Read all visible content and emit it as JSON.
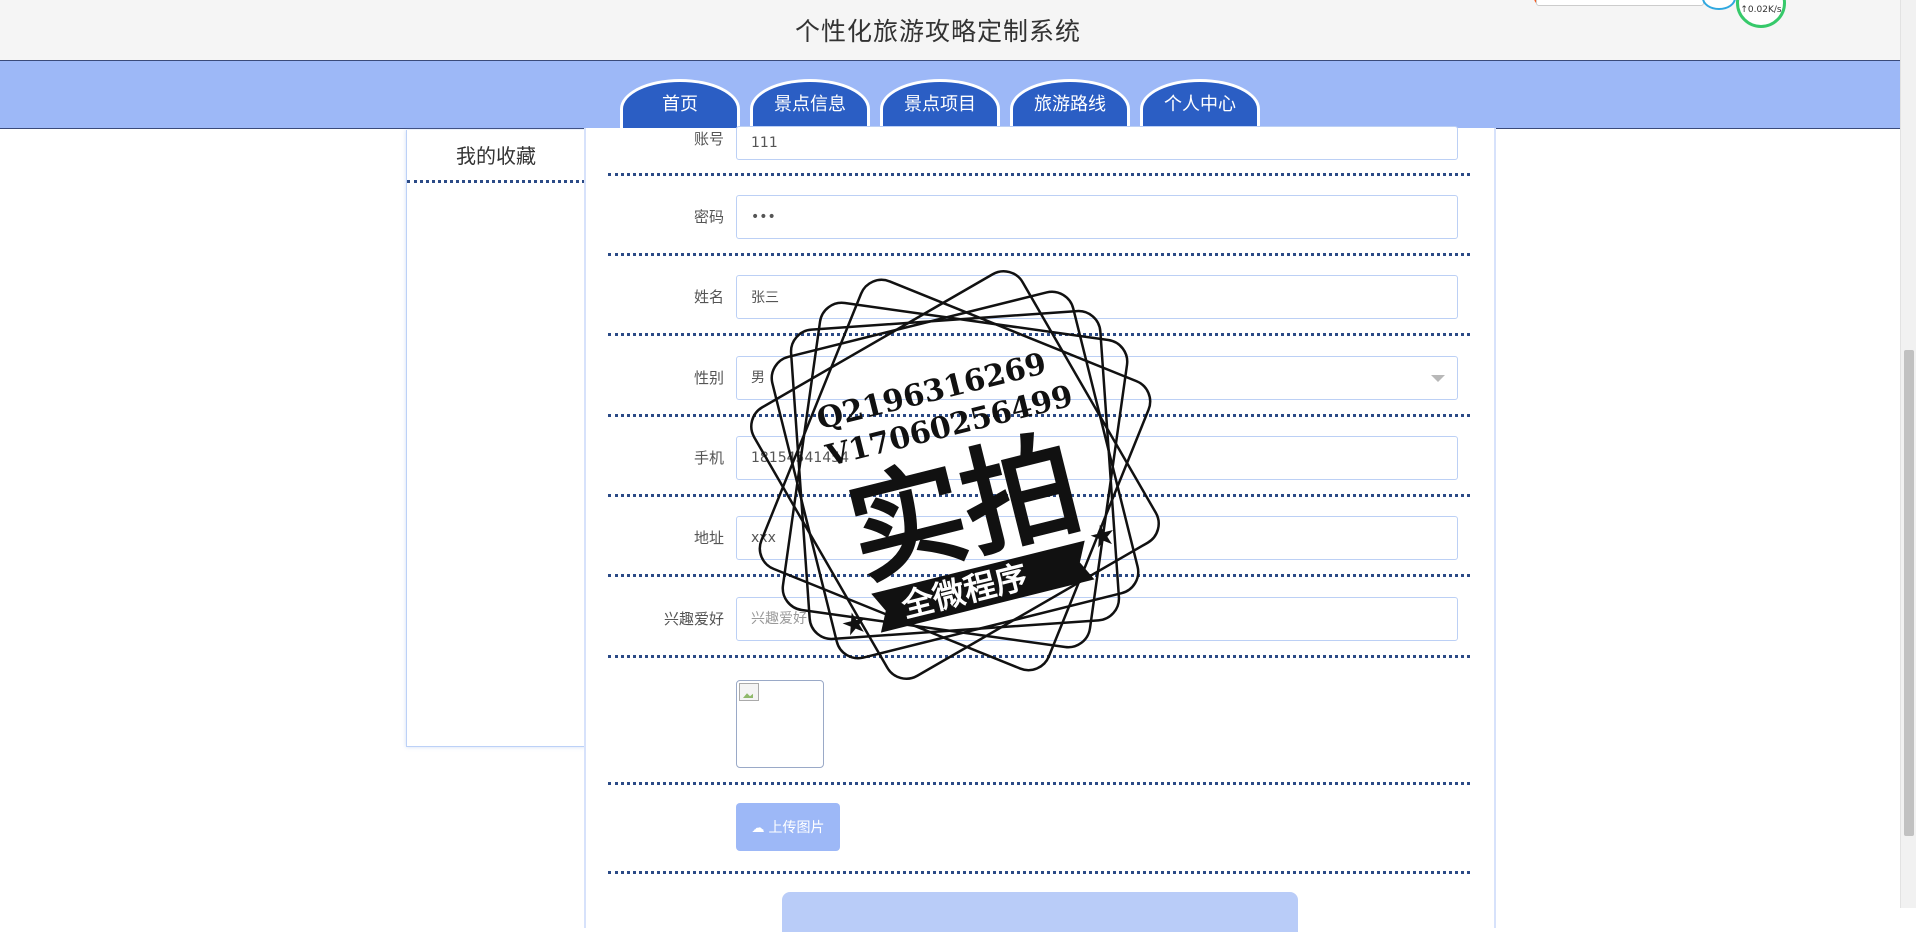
{
  "header": {
    "site_title": "个性化旅游攻略定制系统",
    "network_speed": "↑0.02K/s"
  },
  "nav": {
    "tabs": [
      {
        "label": "首页"
      },
      {
        "label": "景点信息"
      },
      {
        "label": "景点项目"
      },
      {
        "label": "旅游路线"
      },
      {
        "label": "个人中心"
      }
    ]
  },
  "sidebar": {
    "items": [
      {
        "label": "我的收藏"
      }
    ]
  },
  "form": {
    "account": {
      "label": "账号",
      "value": "111"
    },
    "password": {
      "label": "密码",
      "value": "•••"
    },
    "name": {
      "label": "姓名",
      "value": "张三"
    },
    "gender": {
      "label": "性别",
      "value": "男"
    },
    "phone": {
      "label": "手机",
      "value": "18154541454"
    },
    "address": {
      "label": "地址",
      "value": "xxx"
    },
    "hobby": {
      "label": "兴趣爱好",
      "placeholder": "兴趣爱好"
    },
    "upload_label": "上传图片"
  },
  "watermark": {
    "line1": "Q2196316269",
    "line2": "V17060256499",
    "main": "实拍",
    "banner": "全微程序"
  },
  "colors": {
    "nav_bar": "#9db8f7",
    "nav_tab": "#2b5ec4",
    "upload_button": "#9db8f7",
    "divider": "#2b4a86"
  }
}
